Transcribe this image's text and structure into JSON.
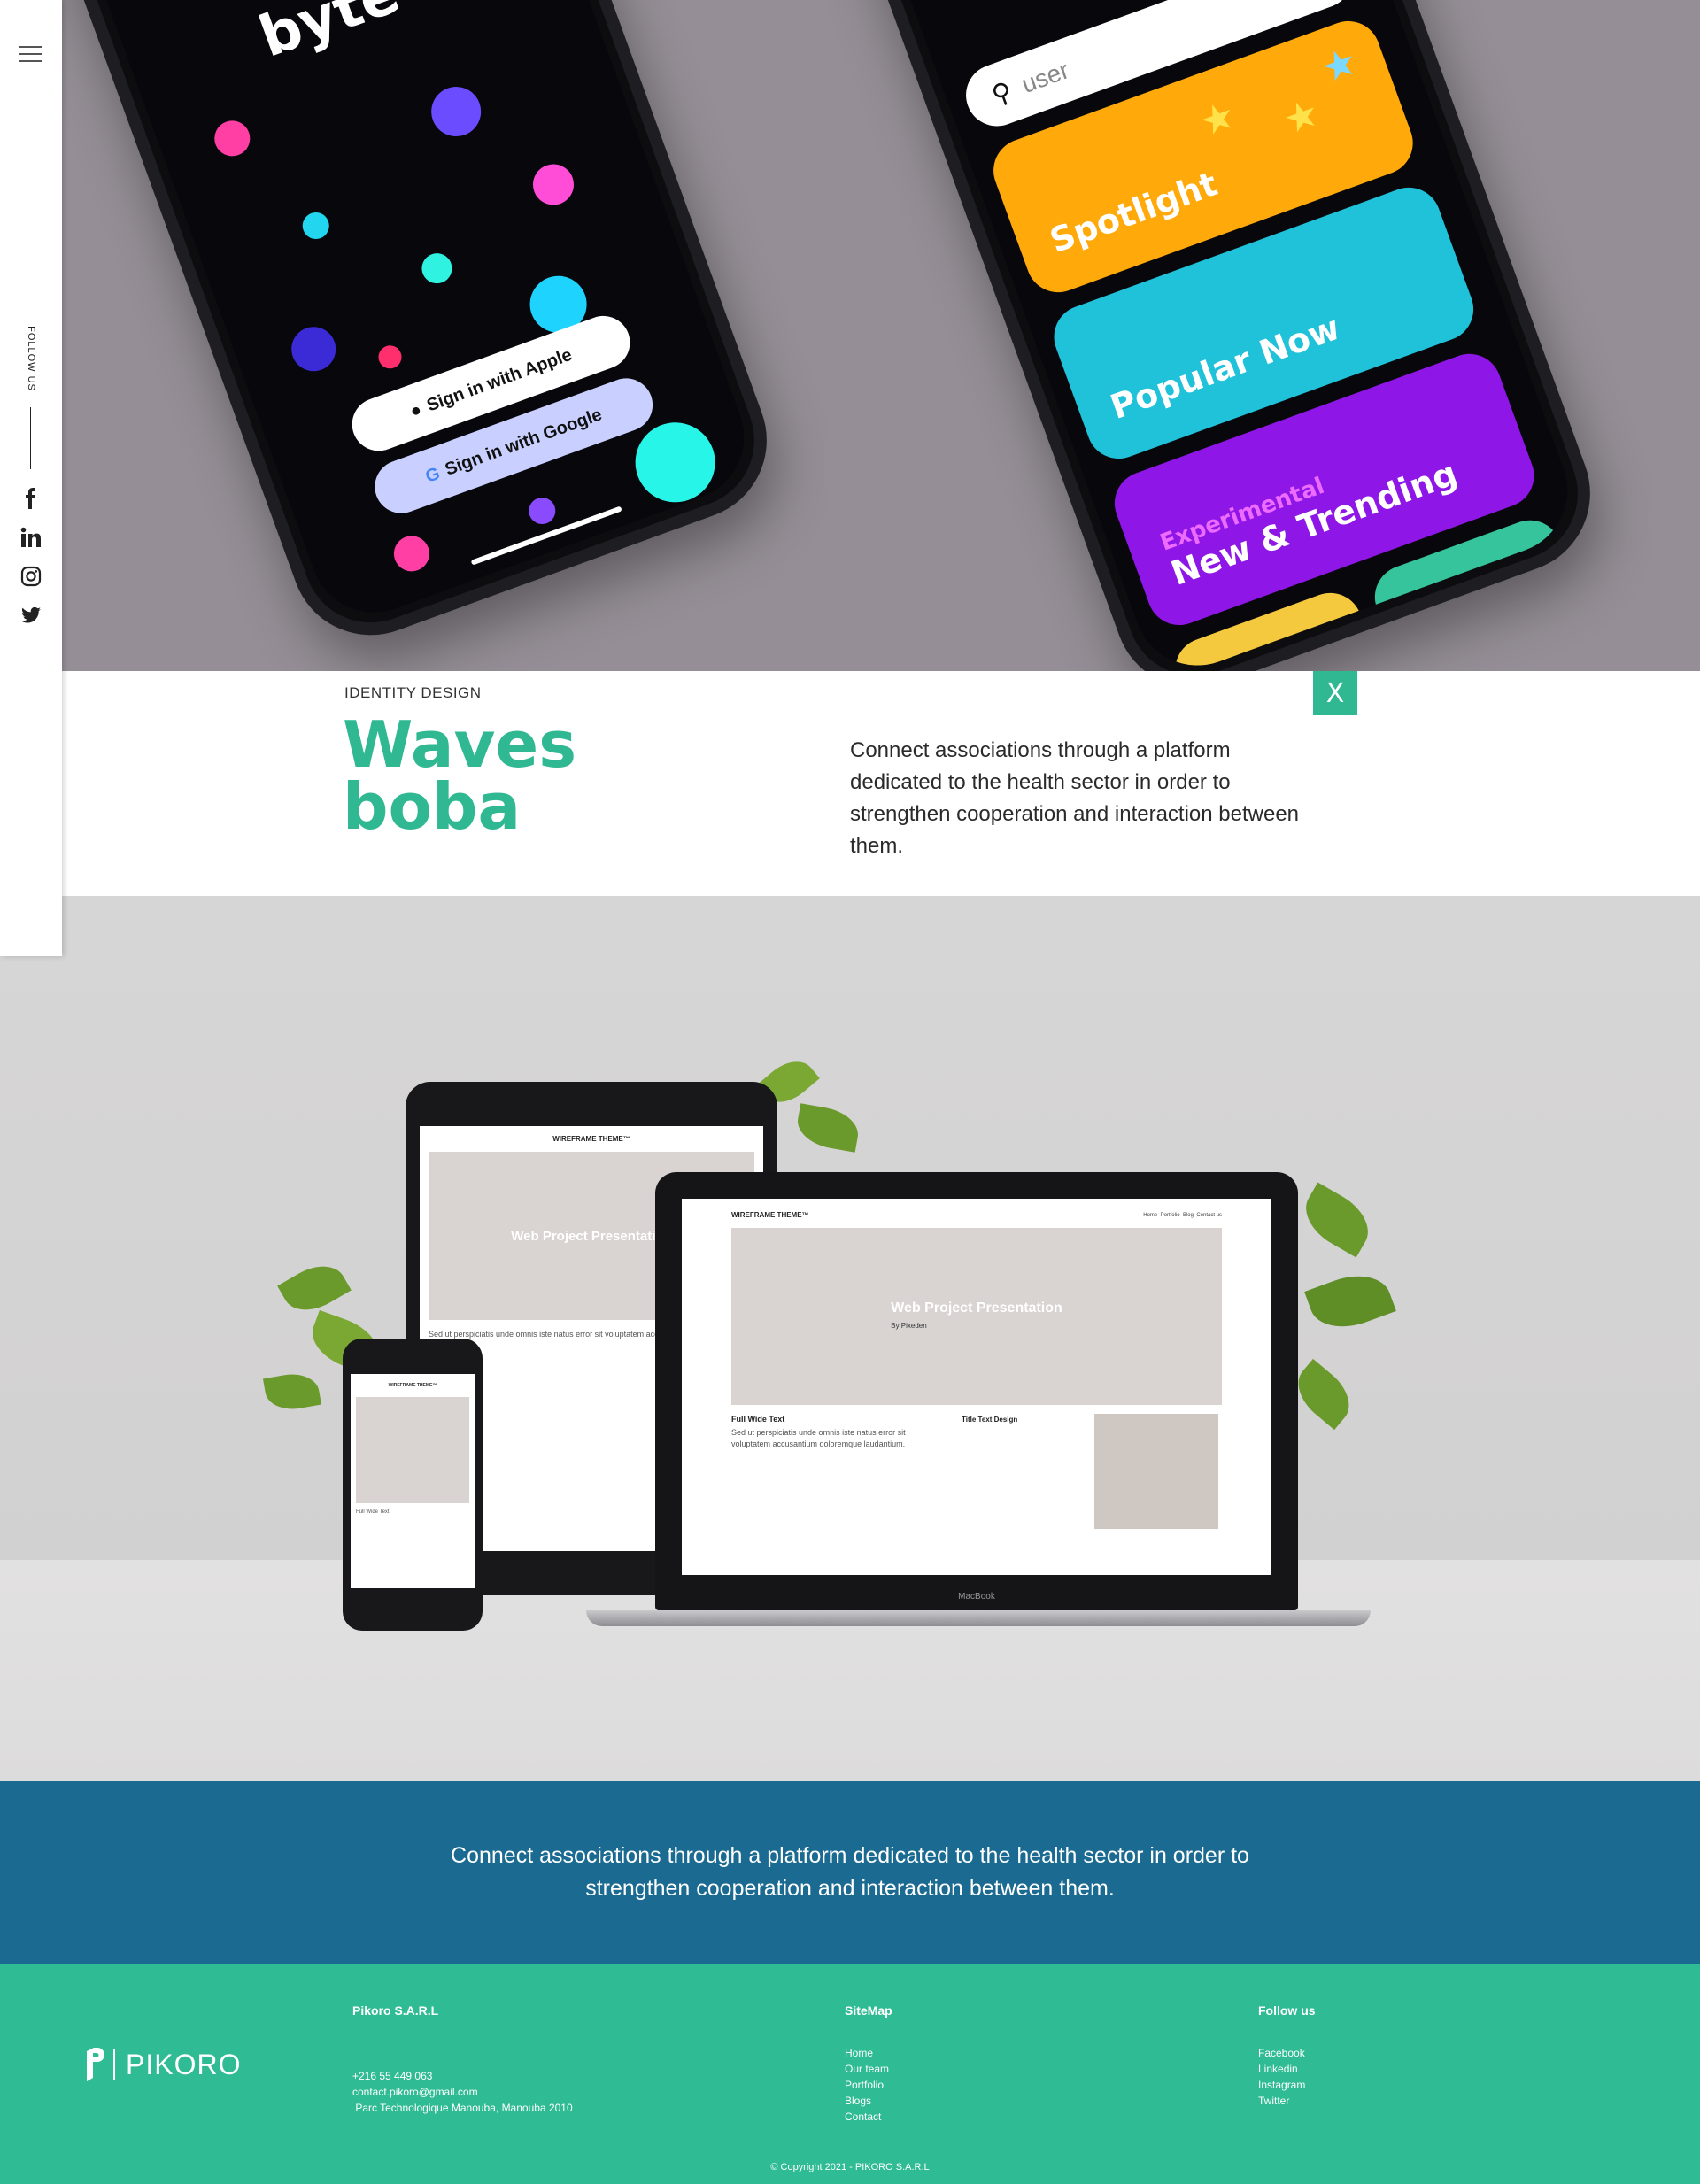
{
  "sidebar": {
    "follow_label": "FOLLOW US",
    "socials": [
      "facebook-icon",
      "linkedin-icon",
      "instagram-icon",
      "twitter-icon"
    ]
  },
  "hero": {
    "left_phone": {
      "logo": "byte",
      "apple_button": "Sign in with Apple",
      "google_button": "Sign in with Google"
    },
    "right_phone": {
      "search_placeholder": "user",
      "cards": {
        "spotlight": "Spotlight",
        "popular": "Popular Now",
        "trend_sub": "Experimental",
        "trend": "New & Trending"
      }
    }
  },
  "project": {
    "category": "IDENTITY DESIGN",
    "title_line1": "Waves",
    "title_line2": "boba",
    "description": "Connect associations through a platform dedicated to the health sector in order to strengthen cooperation and interaction between them.",
    "close_label": "X"
  },
  "mockup": {
    "site_name": "WIREFRAME THEME™",
    "hero_title": "Web Project Presentation",
    "hero_by": "By Pixeden",
    "section_title": "Full Wide Text",
    "section_text": "Sed ut perspiciatis unde omnis iste natus error sit voluptatem accusantium doloremque laudantium.",
    "side_title": "Title Text Design",
    "laptop_brand": "MacBook",
    "nav": [
      "Home",
      "Portfolio",
      "Blog",
      "Contact us"
    ]
  },
  "quote": {
    "text": "Connect associations through a platform dedicated to the health sector in order to strengthen cooperation and interaction between them."
  },
  "footer": {
    "logo_text": "PIKORO",
    "company": {
      "title": "Pikoro S.A.R.L",
      "phone": "+216 55 449 063",
      "email": "contact.pikoro@gmail.com",
      "address": " Parc Technologique Manouba, Manouba 2010"
    },
    "sitemap": {
      "title": "SiteMap",
      "links": [
        "Home",
        "Our team",
        "Portfolio",
        "Blogs",
        "Contact"
      ]
    },
    "follow": {
      "title": "Follow us",
      "links": [
        "Facebook",
        "Linkedin",
        "Instagram",
        "Twitter"
      ]
    },
    "copyright": "© Copyright 2021 - PIKORO S.A.R.L"
  },
  "colors": {
    "accent": "#2fb892",
    "quote_band": "#1a6a91",
    "footer": "#2fbb93",
    "hero_bg": "#958e96"
  }
}
